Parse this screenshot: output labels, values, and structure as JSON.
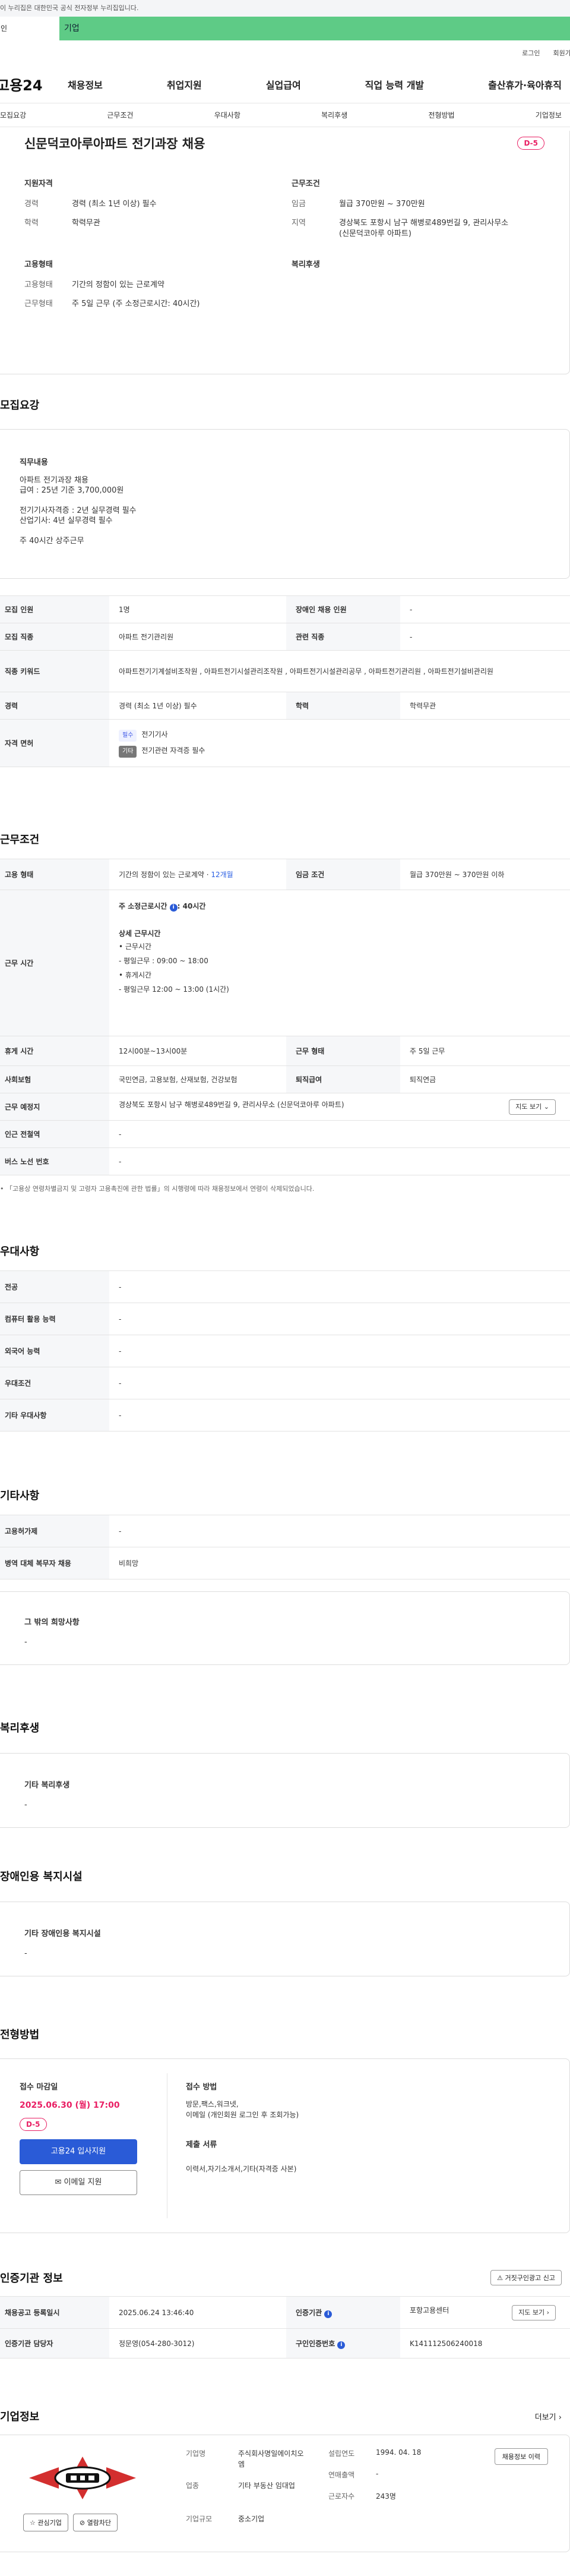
{
  "notice": "이 누리집은 대한민국 공식 전자정부 누리집입니다.",
  "audience": {
    "person": "개인",
    "company": "기업"
  },
  "topbar": {
    "login": "로그인",
    "signup": "회원가입"
  },
  "gnb": {
    "logo": "고용24",
    "menu": [
      "채용정보",
      "취업지원",
      "실업급여",
      "직업 능력 개발",
      "출산휴가·육아휴직"
    ]
  },
  "anchors": [
    "모집요강",
    "근무조건",
    "우대사항",
    "복리후생",
    "전형방법",
    "기업정보"
  ],
  "job": {
    "title": "신문덕코아루아파트 전기과장 채용",
    "dday": "D-5",
    "qual_title": "지원자격",
    "career_k": "경력",
    "career_v": "경력 (최소 1년 이상) 필수",
    "edu_k": "학력",
    "edu_v": "학력무관",
    "cond_title": "근무조건",
    "wage_k": "임금",
    "wage_v": "월급 370만원 ~ 370만원",
    "loc_k": "지역",
    "loc_v": "경상북도 포항시 남구 해병로489번길 9, 관리사무소 (신문덕코아루 아파트)",
    "emp_title": "고용형태",
    "emp_k": "고용형태",
    "emp_v": "기간의 정함이 있는 근로계약",
    "wt_k": "근무형태",
    "wt_v": "주 5일 근무 (주 소정근로시간: 40시간)",
    "welfare_title": "복리후생"
  },
  "recruit": {
    "section_title": "모집요강",
    "box_title": "직무내용",
    "lines1": [
      "아파트 전기과장 채용",
      "급여 : 25년 기준 3,700,000원"
    ],
    "lines2": [
      "전기기사자격증 : 2년 실무경력 필수",
      "산업기사: 4년 실무경력 필수"
    ],
    "lines3": [
      "주 40시간 상주근무"
    ],
    "rows": {
      "count_k": "모집 인원",
      "count_v": "1명",
      "disabled_k": "장애인 채용 인원",
      "disabled_v": "-",
      "job_k": "모집 직종",
      "job_v": "아파트 전기관리원",
      "rel_k": "관련 직종",
      "rel_v": "-",
      "kw_k": "직종 키워드",
      "kw_v": "아파트전기기계설비조작원 , 아파트전기시설관리조작원 , 아파트전기시설관리공무 , 아파트전기관리원 , 아파트전기설비관리원",
      "car_k": "경력",
      "car_v": "경력 (최소 1년 이상) 필수",
      "edu_k": "학력",
      "edu_v": "학력무관",
      "lic_k": "자격 면허",
      "lic_req_badge": "필수",
      "lic_req": "전기기사",
      "lic_opt_badge": "기타",
      "lic_opt": "전기관련 자격증 필수"
    }
  },
  "work": {
    "section_title": "근무조건",
    "emp_k": "고용 형태",
    "emp_v": "기간의 정함이 있는 근로계약 · ",
    "emp_link": "12개월",
    "wage_k": "임금 조건",
    "wage_v": "월급 370만원 ~ 370만원 이하",
    "time_k": "근무 시간",
    "time_main": "주 소정근로시간 ",
    "time_hours": ": 40시간",
    "time_detail_title": "상세 근무시간",
    "time_lines": [
      "• 근무시간",
      "- 평일근무 : 09:00 ~ 18:00",
      "• 휴게시간",
      "- 평일근무 12:00 ~ 13:00 (1시간)"
    ],
    "break_k": "휴게 시간",
    "break_v": "12시00분~13시00분",
    "wtype_k": "근무 형태",
    "wtype_v": "주 5일 근무",
    "ins_k": "사회보험",
    "ins_v": "국민연금, 고용보험, 산재보험, 건강보험",
    "ret_k": "퇴직급여",
    "ret_v": "퇴직연금",
    "place_k": "근무 예정지",
    "place_v": "경상북도 포항시 남구 해병로489번길 9, 관리사무소 (신문덕코아루 아파트)",
    "map_btn": "지도 보기",
    "subway_k": "인근 전철역",
    "subway_v": "-",
    "bus_k": "버스 노선 번호",
    "bus_v": "-",
    "footnote": "「고용상 연령차별금지 및 고령자 고용촉진에 관한 법률」의 시행령에 따라 채용정보에서 연령이 삭제되었습니다."
  },
  "pref": {
    "section_title": "우대사항",
    "major_k": "전공",
    "major_v": "-",
    "pc_k": "컴퓨터 활용 능력",
    "pc_v": "-",
    "lang_k": "외국어 능력",
    "lang_v": "-",
    "cond_k": "우대조건",
    "cond_v": "-",
    "etc_k": "기타 우대사항",
    "etc_v": "-"
  },
  "etc": {
    "section_title": "기타사항",
    "ins_k": "고용허가제",
    "ins_v": "-",
    "mil_k": "병역 대체 복무자 채용",
    "mil_v": "비희망",
    "other_title": "그 밖의 희망사항",
    "other_v": "-"
  },
  "welfare": {
    "section_title": "복리후생",
    "box_title": "기타 복리후생",
    "box_v": "-"
  },
  "disabled": {
    "section_title": "장애인용 복지시설",
    "box_title": "기타 장애인용 복지시설",
    "box_v": "-"
  },
  "process": {
    "section_title": "전형방법",
    "deadline_label": "접수 마감일",
    "deadline": "2025.06.30 (월) 17:00",
    "dday": "D-5",
    "apply_btn": "고용24 입사지원",
    "email_btn": "이메일 지원",
    "method_label": "접수 방법",
    "method_v1": "방문,팩스,워크넷,",
    "method_v2": "이메일 (개인회원 로그인 후 조회가능)",
    "docs_label": "제출 서류",
    "docs_v": "이력서,자기소개서,기타(자격증 사본)"
  },
  "cert": {
    "section_title": "인증기관 정보",
    "report_btn": "거짓구인광고 신고",
    "reg_k": "채용공고 등록일시",
    "reg_v": "2025.06.24 13:46:40",
    "org_k": "인증기관",
    "org_v": "포항고용센터",
    "map_btn": "지도 보기",
    "mgr_k": "인증기관 담당자",
    "mgr_v": "정문영(054-280-3012)",
    "num_k": "구인인증번호",
    "num_v": "K141112506240018"
  },
  "company": {
    "section_title": "기업정보",
    "more": "더보기",
    "interest_btn": "관심기업",
    "block_btn": "열람차단",
    "name_k": "기업명",
    "name_v": "주식회사명일에이치오엠",
    "ind_k": "업종",
    "ind_v": "기타 부동산 임대업",
    "scale_k": "기업규모",
    "scale_v": "중소기업",
    "est_k": "설립연도",
    "est_v": "1994. 04. 18",
    "sales_k": "연매출액",
    "sales_v": "-",
    "emp_k": "근로자수",
    "emp_v": "243명",
    "hist_btn": "채용정보 이력"
  },
  "colors": {
    "accent": "#2a5bd7",
    "dday": "#e91e63",
    "company_bar": "#5ecb86"
  }
}
